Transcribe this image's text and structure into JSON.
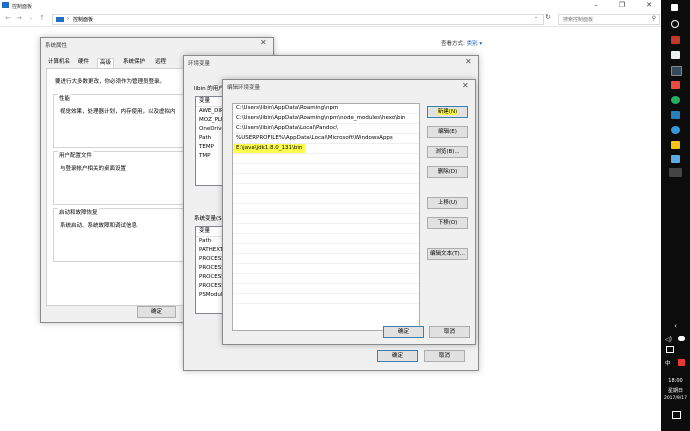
{
  "window": {
    "title": "控制面板",
    "minimize": "–",
    "restore": "❐",
    "close": "✕"
  },
  "address": {
    "breadcrumb": "控制面板",
    "separator": "›",
    "search_placeholder": "搜索控制面板"
  },
  "view": {
    "label": "查看方式:",
    "value": "类别 ▾"
  },
  "system_props": {
    "title": "系统属性",
    "tabs": [
      "计算机名",
      "硬件",
      "高级",
      "系统保护",
      "远程"
    ],
    "intro": "要进行大多数更改，你必须作为管理员登录。",
    "perf_group": "性能",
    "perf_text": "视觉效果，处理器计划，内存使用，以及虚拟内",
    "profile_group": "用户配置文件",
    "profile_text": "与登录帐户相关的桌面设置",
    "startup_group": "启动和故障恢复",
    "startup_text": "系统启动、系统故障和调试信息",
    "ok": "确定"
  },
  "env_vars": {
    "title": "环境变量",
    "user_label": "libin 的用户",
    "user_header": "变量",
    "user_vars": [
      "AWE_DIR",
      "MOZ_PLU",
      "OneDrive",
      "Path",
      "TEMP",
      "TMP"
    ],
    "sys_label": "系统变量(S)",
    "sys_header": "变量",
    "sys_vars": [
      "Path",
      "PATHEXT",
      "PROCESS",
      "PROCESS",
      "PROCESS",
      "PROCESS",
      "PSModul"
    ],
    "ok": "确定",
    "cancel": "取消"
  },
  "edit_env": {
    "title": "编辑环境变量",
    "entries": [
      "C:\\Users\\libin\\AppData\\Roaming\\npm",
      "C:\\Users\\libin\\AppData\\Roaming\\npm\\node_modules\\hexo\\bin",
      "C:\\Users\\libin\\AppData\\Local\\Pandoc\\",
      "%USERPROFILE%\\AppData\\Local\\Microsoft\\WindowsApps",
      "E:\\java\\jdk1.8.0_131\\bin"
    ],
    "buttons": {
      "new": "新建(N)",
      "edit": "编辑(E)",
      "browse": "浏览(B)...",
      "delete": "删除(D)",
      "up": "上移(U)",
      "down": "下移(O)",
      "edit_text": "编辑文本(T)..."
    },
    "ok": "确定",
    "cancel": "取消",
    "close": "✕"
  },
  "taskbar": {
    "expand": "‹",
    "ime": "中",
    "time": "18:00",
    "weekday": "星期日",
    "date": "2017/9/17",
    "tray_icons": [
      "volume-icon",
      "network-icon",
      "ime-icon",
      "antivirus-icon"
    ]
  },
  "colors": {
    "highlight": "#ffff4d",
    "taskbar": "#0c0c0c",
    "link": "#1565c0"
  }
}
